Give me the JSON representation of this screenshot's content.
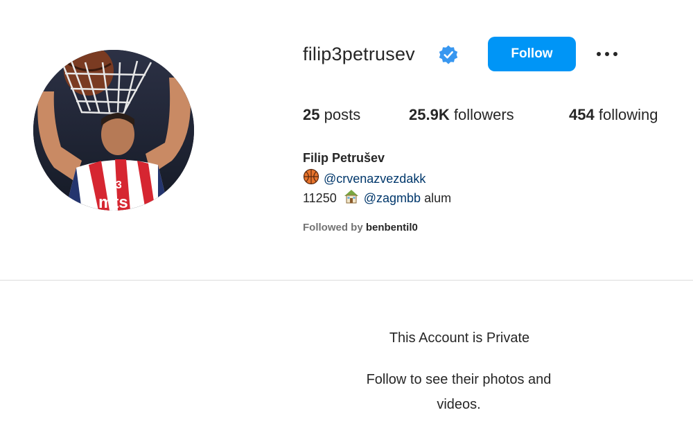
{
  "profile": {
    "username": "filip3petrusev",
    "verified_icon": "verified-badge-icon",
    "follow_label": "Follow",
    "more_icon": "more-options-icon",
    "stats": {
      "posts_count": "25",
      "posts_label": "posts",
      "followers_count": "25.9K",
      "followers_label": "followers",
      "following_count": "454",
      "following_label": "following"
    },
    "full_name": "Filip Petrušev",
    "bio": {
      "line1_icon": "basketball-icon",
      "line1_mention": "@crvenazvezdakk",
      "line2_prefix": "11250",
      "line2_icon": "house-icon",
      "line2_mention": "@zagmbb",
      "line2_suffix": "alum"
    },
    "followed_by_label": "Followed by",
    "followed_by_user": "benbentil0"
  },
  "private_notice": {
    "title": "This Account is Private",
    "subtitle": "Follow to see their photos and videos."
  },
  "colors": {
    "accent": "#0095f6",
    "text": "#262626",
    "muted": "#737373",
    "mention": "#00376b",
    "divider": "#dbdbdb"
  }
}
